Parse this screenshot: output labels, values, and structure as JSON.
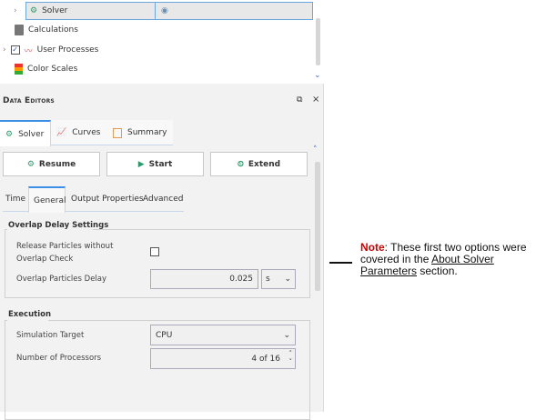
{
  "tree": {
    "items": [
      {
        "label": "Solver",
        "selected": true
      },
      {
        "label": "Calculations"
      },
      {
        "label": "User Processes",
        "checked": true
      },
      {
        "label": "Color Scales"
      }
    ]
  },
  "panel": {
    "title": "Data Editors",
    "float_icon": "float-icon",
    "close_icon": "×"
  },
  "tabs": [
    {
      "label": "Solver",
      "active": true
    },
    {
      "label": "Curves"
    },
    {
      "label": "Summary"
    }
  ],
  "toolbar": {
    "resume": "Resume",
    "start": "Start",
    "extend": "Extend"
  },
  "subtabs": [
    {
      "label": "Time"
    },
    {
      "label": "General",
      "active": true
    },
    {
      "label": "Output Properties"
    },
    {
      "label": "Advanced"
    }
  ],
  "overlap": {
    "title": "Overlap Delay Settings",
    "release_label": "Release Particles without Overlap Check",
    "release_checked": false,
    "delay_label": "Overlap Particles Delay",
    "delay_value": "0.025",
    "delay_unit": "s"
  },
  "execution": {
    "title": "Execution",
    "target_label": "Simulation Target",
    "target_value": "CPU",
    "processors_label": "Number of Processors",
    "processors_value": "4 of 16"
  },
  "note": {
    "prefix": "Note",
    "text": ": These first two options were covered in the ",
    "link": "About Solver Parameters",
    "suffix": " section."
  },
  "colors": {
    "accent": "#3a8ee6",
    "note_red": "#cc0000"
  }
}
